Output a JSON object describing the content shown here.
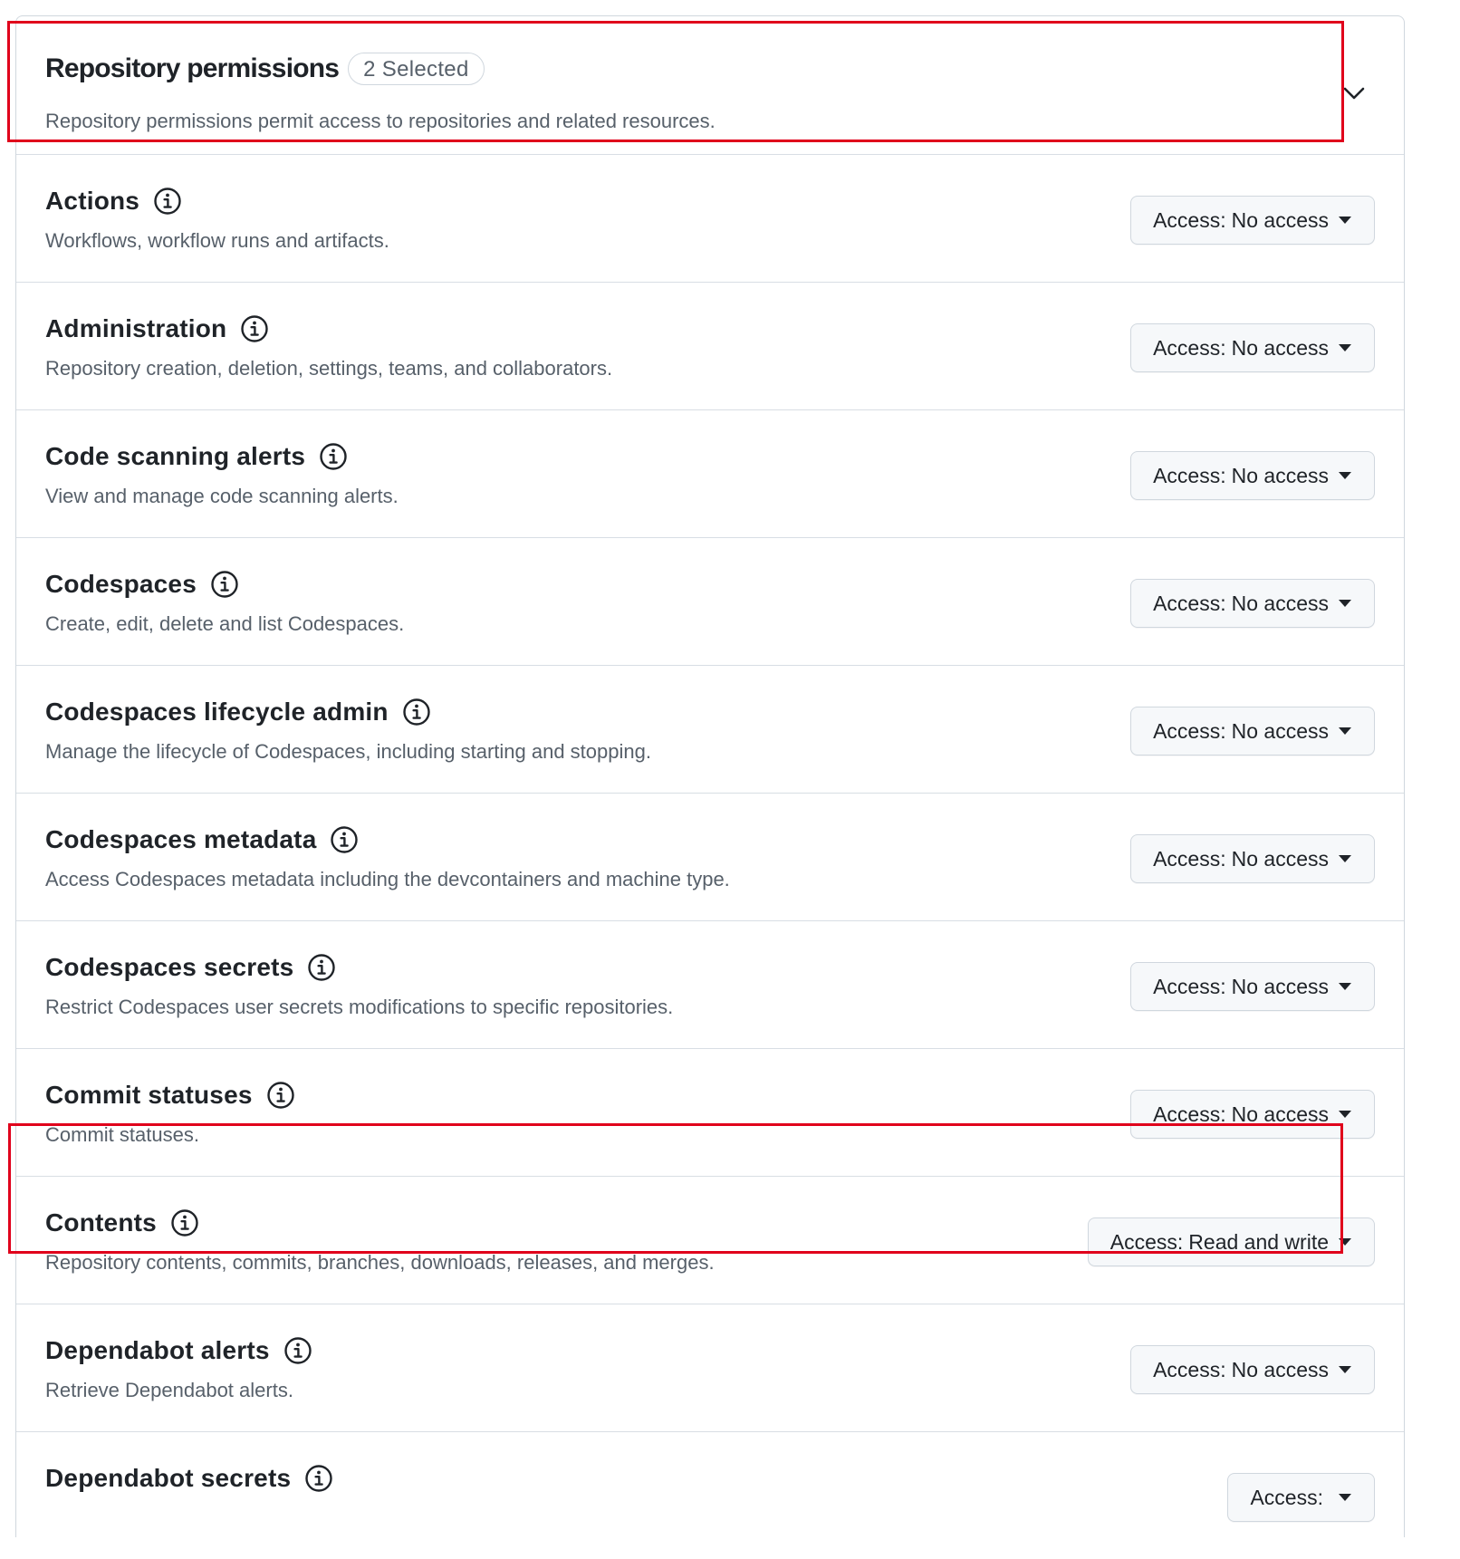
{
  "section": {
    "title": "Repository permissions",
    "badge": "2 Selected",
    "description": "Repository permissions permit access to repositories and related resources.",
    "toggle_icon": "chevron-down-icon"
  },
  "access_prefix": "Access:",
  "permissions": [
    {
      "title": "Actions",
      "description": "Workflows, workflow runs and artifacts.",
      "access": "No access"
    },
    {
      "title": "Administration",
      "description": "Repository creation, deletion, settings, teams, and collaborators.",
      "access": "No access"
    },
    {
      "title": "Code scanning alerts",
      "description": "View and manage code scanning alerts.",
      "access": "No access"
    },
    {
      "title": "Codespaces",
      "description": "Create, edit, delete and list Codespaces.",
      "access": "No access"
    },
    {
      "title": "Codespaces lifecycle admin",
      "description": "Manage the lifecycle of Codespaces, including starting and stopping.",
      "access": "No access"
    },
    {
      "title": "Codespaces metadata",
      "description": "Access Codespaces metadata including the devcontainers and machine type.",
      "access": "No access"
    },
    {
      "title": "Codespaces secrets",
      "description": "Restrict Codespaces user secrets modifications to specific repositories.",
      "access": "No access"
    },
    {
      "title": "Commit statuses",
      "description": "Commit statuses.",
      "access": "No access"
    },
    {
      "title": "Contents",
      "description": "Repository contents, commits, branches, downloads, releases, and merges.",
      "access": "Read and write"
    },
    {
      "title": "Dependabot alerts",
      "description": "Retrieve Dependabot alerts.",
      "access": "No access"
    },
    {
      "title": "Dependabot secrets",
      "description": "",
      "access": ""
    }
  ],
  "colors": {
    "highlight": "#e0001b",
    "border": "#d0d7de",
    "muted_text": "#57606a",
    "button_bg": "#f6f8fa"
  }
}
